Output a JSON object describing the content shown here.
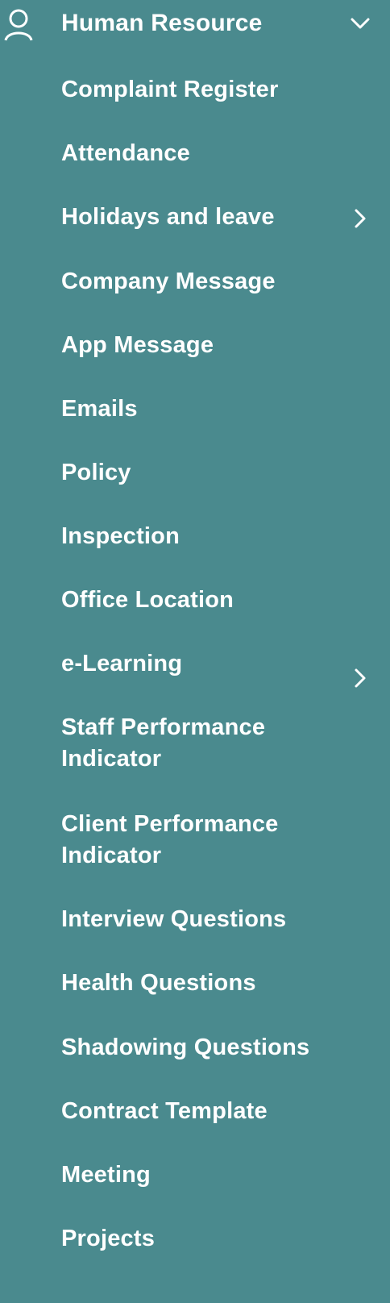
{
  "menu": {
    "header": {
      "label": "Human Resource",
      "icon": "user-icon",
      "expanded_icon": "chevron-down-icon"
    },
    "items": [
      {
        "label": "Complaint Register",
        "has_submenu": false
      },
      {
        "label": "Attendance",
        "has_submenu": false
      },
      {
        "label": "Holidays and leave",
        "has_submenu": true,
        "submenu_icon": "chevron-right-icon"
      },
      {
        "label": "Company Message",
        "has_submenu": false
      },
      {
        "label": "App Message",
        "has_submenu": false
      },
      {
        "label": "Emails",
        "has_submenu": false
      },
      {
        "label": "Policy",
        "has_submenu": false
      },
      {
        "label": "Inspection",
        "has_submenu": false
      },
      {
        "label": "Office Location",
        "has_submenu": false
      },
      {
        "label": "e-Learning",
        "has_submenu": true,
        "submenu_icon": "chevron-right-icon"
      },
      {
        "label": "Staff Performance Indicator",
        "has_submenu": false
      },
      {
        "label": "Client Performance Indicator",
        "has_submenu": false
      },
      {
        "label": "Interview Questions",
        "has_submenu": false
      },
      {
        "label": "Health Questions",
        "has_submenu": false
      },
      {
        "label": "Shadowing Questions",
        "has_submenu": false
      },
      {
        "label": "Contract Template",
        "has_submenu": false
      },
      {
        "label": "Meeting",
        "has_submenu": false
      },
      {
        "label": "Projects",
        "has_submenu": false
      }
    ]
  },
  "colors": {
    "background": "#4a8a8e",
    "text": "#ffffff"
  }
}
